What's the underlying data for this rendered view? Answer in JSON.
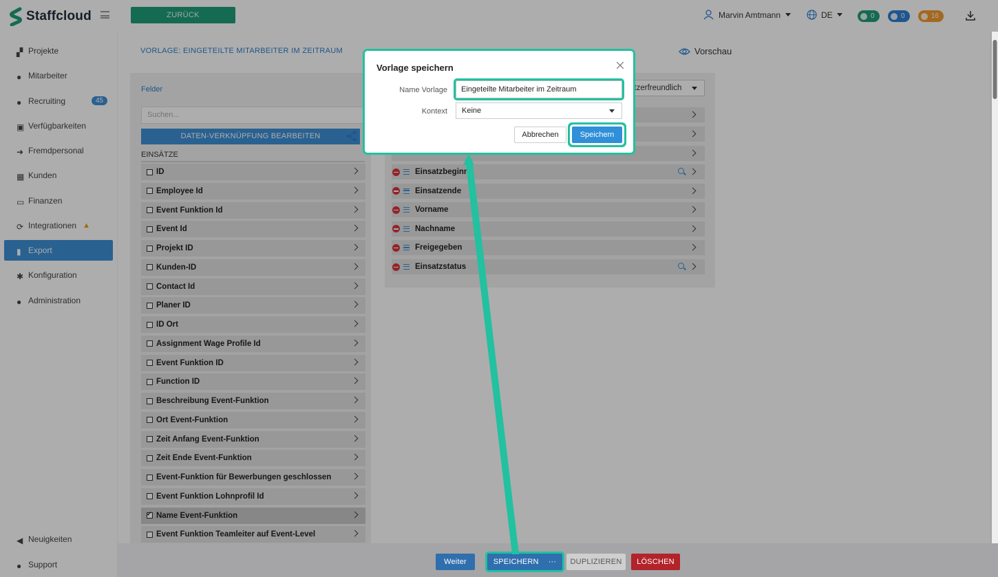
{
  "app": {
    "name": "Staffcloud"
  },
  "header": {
    "back_label": "ZURÜCK",
    "user_name": "Marvin Amtmann",
    "language": "DE",
    "badges": [
      {
        "icon": "chat-icon",
        "count": "0",
        "color": "#1f9d7a"
      },
      {
        "icon": "bell-icon",
        "count": "0",
        "color": "#2f7fd2"
      },
      {
        "icon": "clock-icon",
        "count": "16",
        "color": "#f29a2e"
      }
    ]
  },
  "sidebar": {
    "items": [
      {
        "label": "Projekte",
        "icon": "sitemap-icon"
      },
      {
        "label": "Mitarbeiter",
        "icon": "users-icon"
      },
      {
        "label": "Recruiting",
        "icon": "user-plus-icon",
        "count": "45"
      },
      {
        "label": "Verfügbarkeiten",
        "icon": "calendar-check-icon"
      },
      {
        "label": "Fremdpersonal",
        "icon": "sign-in-icon"
      },
      {
        "label": "Kunden",
        "icon": "building-icon"
      },
      {
        "label": "Finanzen",
        "icon": "money-icon"
      },
      {
        "label": "Integrationen",
        "icon": "sync-icon"
      },
      {
        "label": "Export",
        "icon": "file-icon",
        "active": true
      },
      {
        "label": "Konfiguration",
        "icon": "cog-icon"
      },
      {
        "label": "Administration",
        "icon": "user-cog-icon"
      }
    ],
    "bottom": [
      {
        "label": "Neuigkeiten",
        "icon": "megaphone-icon"
      },
      {
        "label": "Support",
        "icon": "comments-icon"
      }
    ]
  },
  "main": {
    "template_title": "VORLAGE: EINGETEILTE MITARBEITER IM ZEITRAUM",
    "preview_label": "Vorschau",
    "felder_label": "Felder",
    "search_placeholder": "Suchen...",
    "link_button": "DATEN-VERKNÜPFUNG BEARBEITEN",
    "section": "EINSÄTZE",
    "fields": [
      {
        "label": "ID",
        "checked": false
      },
      {
        "label": "Employee Id",
        "checked": false
      },
      {
        "label": "Event Funktion Id",
        "checked": false
      },
      {
        "label": "Event Id",
        "checked": false
      },
      {
        "label": "Projekt ID",
        "checked": false
      },
      {
        "label": "Kunden-ID",
        "checked": false
      },
      {
        "label": "Contact Id",
        "checked": false
      },
      {
        "label": "Planer ID",
        "checked": false
      },
      {
        "label": "ID Ort",
        "checked": false
      },
      {
        "label": "Assignment Wage Profile Id",
        "checked": false
      },
      {
        "label": "Event Funktion ID",
        "checked": false
      },
      {
        "label": "Function ID",
        "checked": false
      },
      {
        "label": "Beschreibung Event-Funktion",
        "checked": false
      },
      {
        "label": "Ort Event-Funktion",
        "checked": false
      },
      {
        "label": "Zeit Anfang Event-Funktion",
        "checked": false
      },
      {
        "label": "Zeit Ende Event-Funktion",
        "checked": false
      },
      {
        "label": "Event-Funktion für Bewerbungen geschlossen",
        "checked": false
      },
      {
        "label": "Event Funktion Lohnprofil Id",
        "checked": false
      },
      {
        "label": "Name Event-Funktion",
        "checked": true
      },
      {
        "label": "Event Funktion Teamleiter auf Event-Level",
        "checked": false
      }
    ],
    "mode_select": "utzerfreundlich",
    "selected_fields": [
      {
        "label": "Einsatzbeginn",
        "search": true
      },
      {
        "label": "Einsatzende",
        "search": false
      },
      {
        "label": "Vorname",
        "search": false
      },
      {
        "label": "Nachname",
        "search": false
      },
      {
        "label": "Freigegeben",
        "search": false
      },
      {
        "label": "Einsatzstatus",
        "search": true
      }
    ]
  },
  "footer": {
    "weiter": "Weiter",
    "speichern": "SPEICHERN",
    "more": "···",
    "duplizieren": "DUPLIZIEREN",
    "loeschen": "LÖSCHEN"
  },
  "modal": {
    "title": "Vorlage speichern",
    "name_label": "Name Vorlage",
    "name_value": "Eingeteilte Mitarbeiter im Zeitraum",
    "context_label": "Kontext",
    "context_value": "Keine",
    "cancel": "Abbrechen",
    "save": "Speichern"
  },
  "colors": {
    "accent": "#3d8fd6",
    "brand_green": "#1f9d7a",
    "highlight": "#22c1a0",
    "danger": "#d9343b"
  }
}
